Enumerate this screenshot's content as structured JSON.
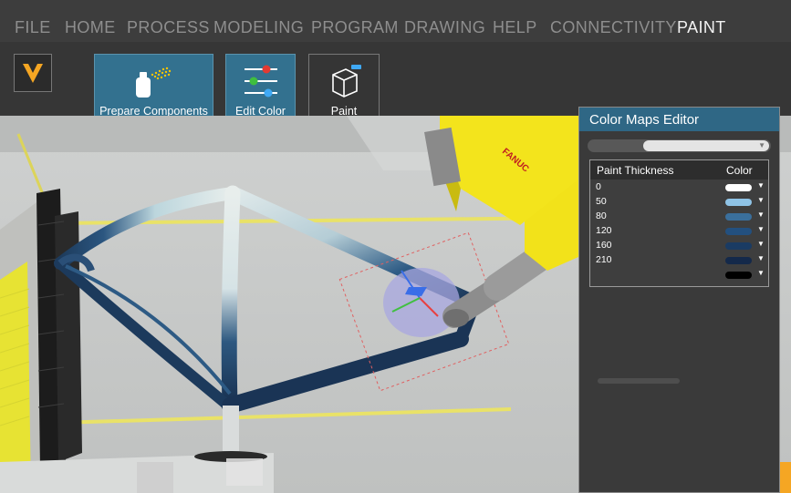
{
  "menu": [
    "FILE",
    "HOME",
    "PROCESS",
    "MODELING",
    "PROGRAM",
    "DRAWING",
    "HELP",
    "CONNECTIVITY",
    "PAINT"
  ],
  "active_menu": "PAINT",
  "ribbon": {
    "prepare": "Prepare Components for Painting",
    "edit_color_maps": "Edit Color Maps",
    "paint_thickness": "Paint Thickness"
  },
  "robot_brand": "FANUC",
  "panel": {
    "title": "Color Maps Editor",
    "col_thickness": "Paint Thickness",
    "col_color": "Color",
    "rows": [
      {
        "value": "0",
        "color": "#ffffff"
      },
      {
        "value": "50",
        "color": "#8fc3e6"
      },
      {
        "value": "80",
        "color": "#3a6f9c"
      },
      {
        "value": "120",
        "color": "#23507f"
      },
      {
        "value": "160",
        "color": "#1a3b63"
      },
      {
        "value": "210",
        "color": "#14294a"
      },
      {
        "value": "",
        "color": "#000000"
      }
    ]
  },
  "colors": {
    "accent": "#2f6785",
    "robot_yellow": "#f2e21a",
    "frame_dark": "#1b3556"
  }
}
